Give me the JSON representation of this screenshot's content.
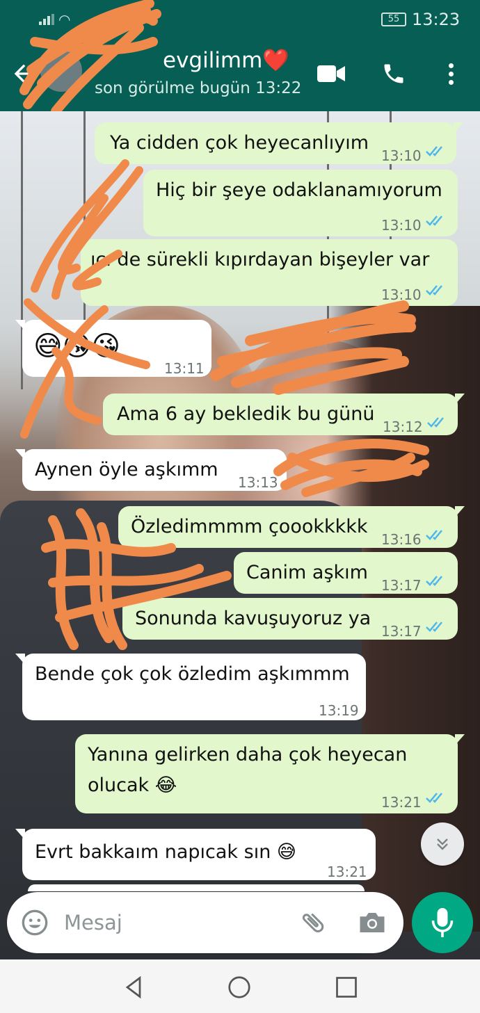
{
  "status_bar": {
    "battery": "55",
    "time": "13:23"
  },
  "header": {
    "contact_name": "Sevgilimm❤️",
    "contact_name_visible": "evgilimm❤️",
    "last_seen": "son görülme bugün 13:22"
  },
  "colors": {
    "header": "#075e54",
    "outgoing_bubble": "#e2f7cb",
    "incoming_bubble": "#ffffff",
    "read_ticks": "#4fb6ec",
    "mic_button": "#00a884",
    "scribble": "#f08a4b"
  },
  "messages": [
    {
      "direction": "out",
      "text": "Ya cidden çok heyecanlıyım",
      "time": "13:10",
      "status": "read"
    },
    {
      "direction": "out",
      "text": "Hiç bir şeye odaklanamıyorum",
      "time": "13:10",
      "status": "read"
    },
    {
      "direction": "out",
      "text": "İçimde sürekli kıpırdayan bişeyler var",
      "visible_text": "ıcı   de sürekli kıpırdayan bişeyler var",
      "time": "13:10",
      "status": "read"
    },
    {
      "direction": "in",
      "text": "😅😘😘",
      "time": "13:11"
    },
    {
      "direction": "out",
      "text": "Ama 6 ay bekledik bu günü",
      "time": "13:12",
      "status": "read"
    },
    {
      "direction": "in",
      "text": "Aynen öyle aşkımm",
      "time": "13:13"
    },
    {
      "direction": "out",
      "text": "Özledimmmm çoookkkkk",
      "time": "13:16",
      "status": "read"
    },
    {
      "direction": "out",
      "text": "Canim aşkım",
      "time": "13:17",
      "status": "read"
    },
    {
      "direction": "out",
      "text": "Sonunda kavuşuyoruz ya",
      "time": "13:17",
      "status": "read"
    },
    {
      "direction": "in",
      "text": "Bende çok çok özledim aşkımmm",
      "time": "13:19"
    },
    {
      "direction": "out",
      "text_line1": "Yanına gelirken daha çok heyecan",
      "text_line2": "olucak 😂",
      "time": "13:21",
      "status": "read"
    },
    {
      "direction": "in",
      "text": "Evrt bakkaım napıcak sın 😅",
      "time": "13:21"
    }
  ],
  "composer": {
    "placeholder": "Mesaj"
  },
  "icons": {
    "back": "arrow-left-icon",
    "video": "video-camera-icon",
    "call": "phone-icon",
    "menu": "more-vertical-icon",
    "emoji": "smiley-icon",
    "attach": "paperclip-icon",
    "camera": "camera-icon",
    "mic": "microphone-icon",
    "scroll_down": "double-chevron-down-icon"
  }
}
